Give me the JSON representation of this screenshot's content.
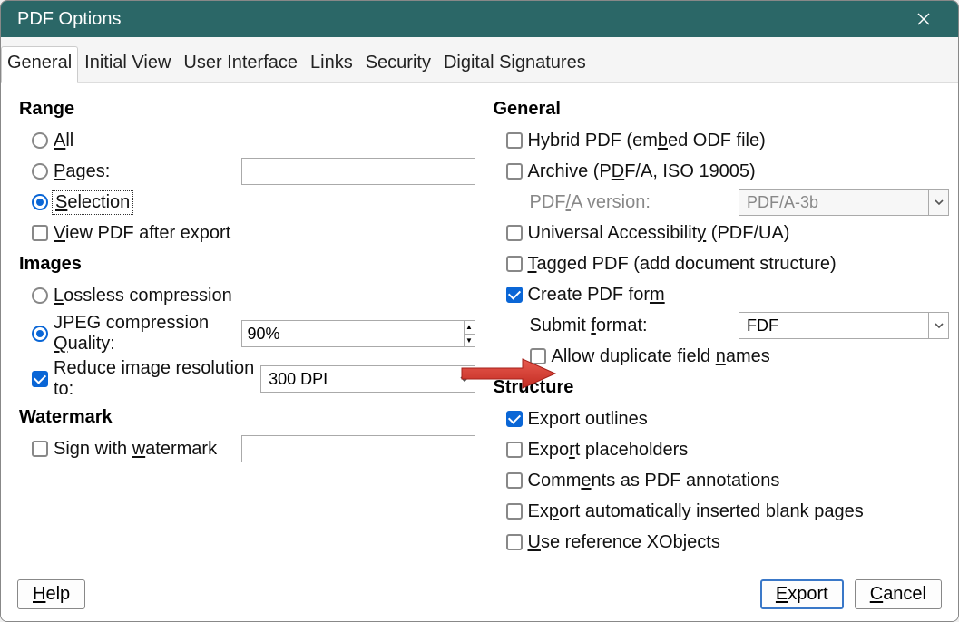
{
  "title": "PDF Options",
  "tabs": [
    "General",
    "Initial View",
    "User Interface",
    "Links",
    "Security",
    "Digital Signatures"
  ],
  "active_tab": 0,
  "left": {
    "range": {
      "title": "Range",
      "all": "All",
      "pages": "Pages:",
      "pages_value": "",
      "selection": "Selection",
      "selected": "selection",
      "view_after": "View PDF after export",
      "view_after_checked": false
    },
    "images": {
      "title": "Images",
      "lossless": "Lossless compression",
      "jpeg": "JPEG compression Quality:",
      "jpeg_value": "90%",
      "selected": "jpeg",
      "reduce": "Reduce image resolution to:",
      "reduce_checked": true,
      "dpi": "300 DPI"
    },
    "watermark": {
      "title": "Watermark",
      "sign": "Sign with watermark",
      "sign_checked": false,
      "value": ""
    }
  },
  "right": {
    "general": {
      "title": "General",
      "hybrid": "Hybrid PDF (embed ODF file)",
      "hybrid_checked": false,
      "archive": "Archive (PDF/A, ISO 19005)",
      "archive_checked": false,
      "pdfa_label": "PDF/A version:",
      "pdfa_value": "PDF/A-3b",
      "ua": "Universal Accessibility (PDF/UA)",
      "ua_checked": false,
      "tagged": "Tagged PDF (add document structure)",
      "tagged_checked": false,
      "form": "Create PDF form",
      "form_checked": true,
      "submit_label": "Submit format:",
      "submit_value": "FDF",
      "dup": "Allow duplicate field names",
      "dup_checked": false
    },
    "structure": {
      "title": "Structure",
      "outlines": "Export outlines",
      "outlines_checked": true,
      "placeholders": "Export placeholders",
      "placeholders_checked": false,
      "comments": "Comments as PDF annotations",
      "comments_checked": false,
      "blank": "Export automatically inserted blank pages",
      "blank_checked": false,
      "xobj": "Use reference XObjects",
      "xobj_checked": false
    }
  },
  "buttons": {
    "help": "Help",
    "export": "Export",
    "cancel": "Cancel"
  },
  "arrow_color": "#d83a2f"
}
